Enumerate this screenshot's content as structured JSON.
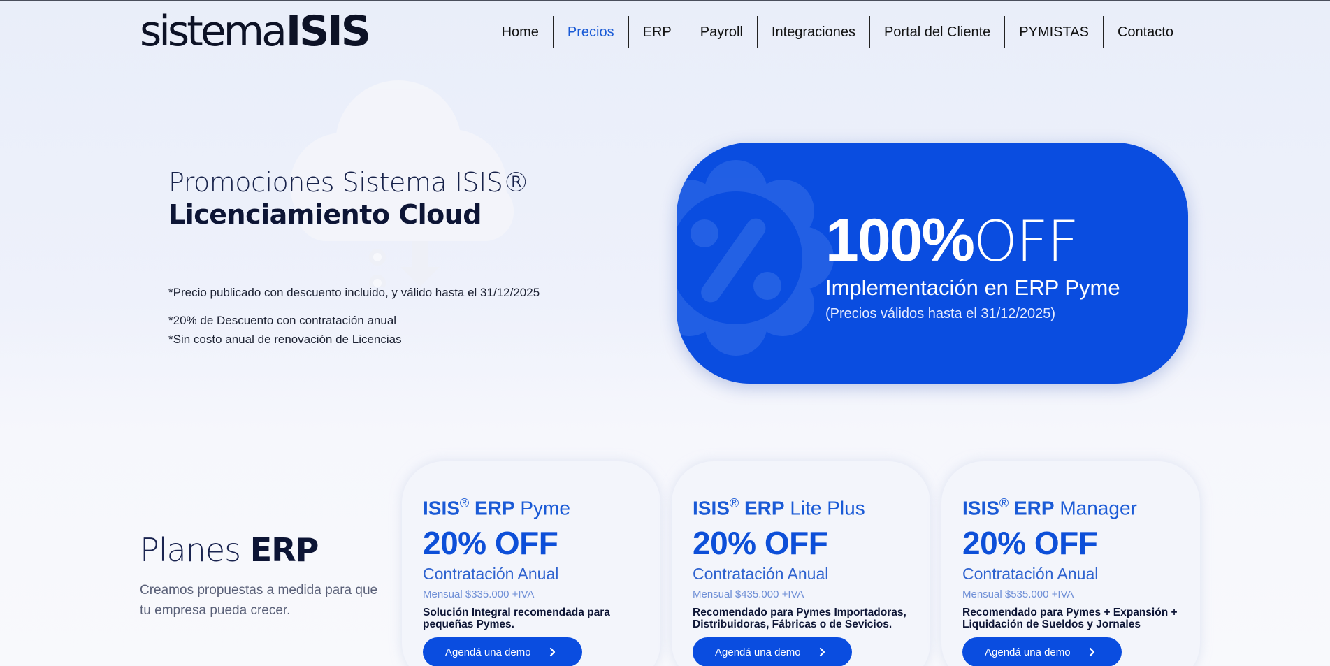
{
  "header": {
    "logo_light": "sistema",
    "logo_bold": "ISIS",
    "nav": [
      {
        "label": "Home",
        "active": false
      },
      {
        "label": "Precios",
        "active": true
      },
      {
        "label": "ERP",
        "active": false
      },
      {
        "label": "Payroll",
        "active": false
      },
      {
        "label": "Integraciones",
        "active": false
      },
      {
        "label": "Portal del Cliente",
        "active": false
      },
      {
        "label": "PYMISTAS",
        "active": false
      },
      {
        "label": "Contacto",
        "active": false
      }
    ]
  },
  "hero": {
    "title_line1": "Promociones Sistema ISIS®",
    "title_line2": "Licenciamiento Cloud",
    "note1": "*Precio publicado con descuento incluido, y válido hasta el 31/12/2025",
    "note2": "*20% de Descuento con contratación anual",
    "note3": "*Sin costo anual de renovación de Licencias"
  },
  "promo": {
    "percent": "100%",
    "off": "OFF",
    "subtitle": "Implementación en ERP Pyme",
    "note": "(Precios válidos hasta el 31/12/2025)"
  },
  "planes": {
    "title_light": "Planes ",
    "title_bold": "ERP",
    "description": "Creamos propuestas a medida para que tu empresa pueda crecer.",
    "cards": [
      {
        "brand": "ISIS",
        "reg": "®",
        "product": "ERP",
        "tier": "Pyme",
        "discount": "20% OFF",
        "contract": "Contratación Anual",
        "monthly": "Mensual $335.000 +IVA",
        "description": "Solución Integral recomendada para pequeñas Pymes.",
        "button": "Agendá una demo"
      },
      {
        "brand": "ISIS",
        "reg": "®",
        "product": "ERP",
        "tier": "Lite Plus",
        "discount": "20% OFF",
        "contract": "Contratación Anual",
        "monthly": "Mensual $435.000 +IVA",
        "description": "Recomendado para Pymes Importadoras, Distribuidoras, Fábricas o de Sevicios.",
        "button": "Agendá una demo"
      },
      {
        "brand": "ISIS",
        "reg": "®",
        "product": "ERP",
        "tier": "Manager",
        "discount": "20% OFF",
        "contract": "Contratación Anual",
        "monthly": "Mensual $535.000 +IVA",
        "description": "Recomendado para Pymes + Expansión + Liquidación de Sueldos y Jornales",
        "button": "Agendá una demo"
      }
    ]
  },
  "colors": {
    "accent": "#0a4de0",
    "link_active": "#1a5ad6",
    "text_dark": "#0d1535"
  },
  "icons": {
    "hero_decoration": "cloud-download-icon",
    "promo_decoration": "discount-badge-icon",
    "button_arrow": "chevron-right-icon"
  }
}
